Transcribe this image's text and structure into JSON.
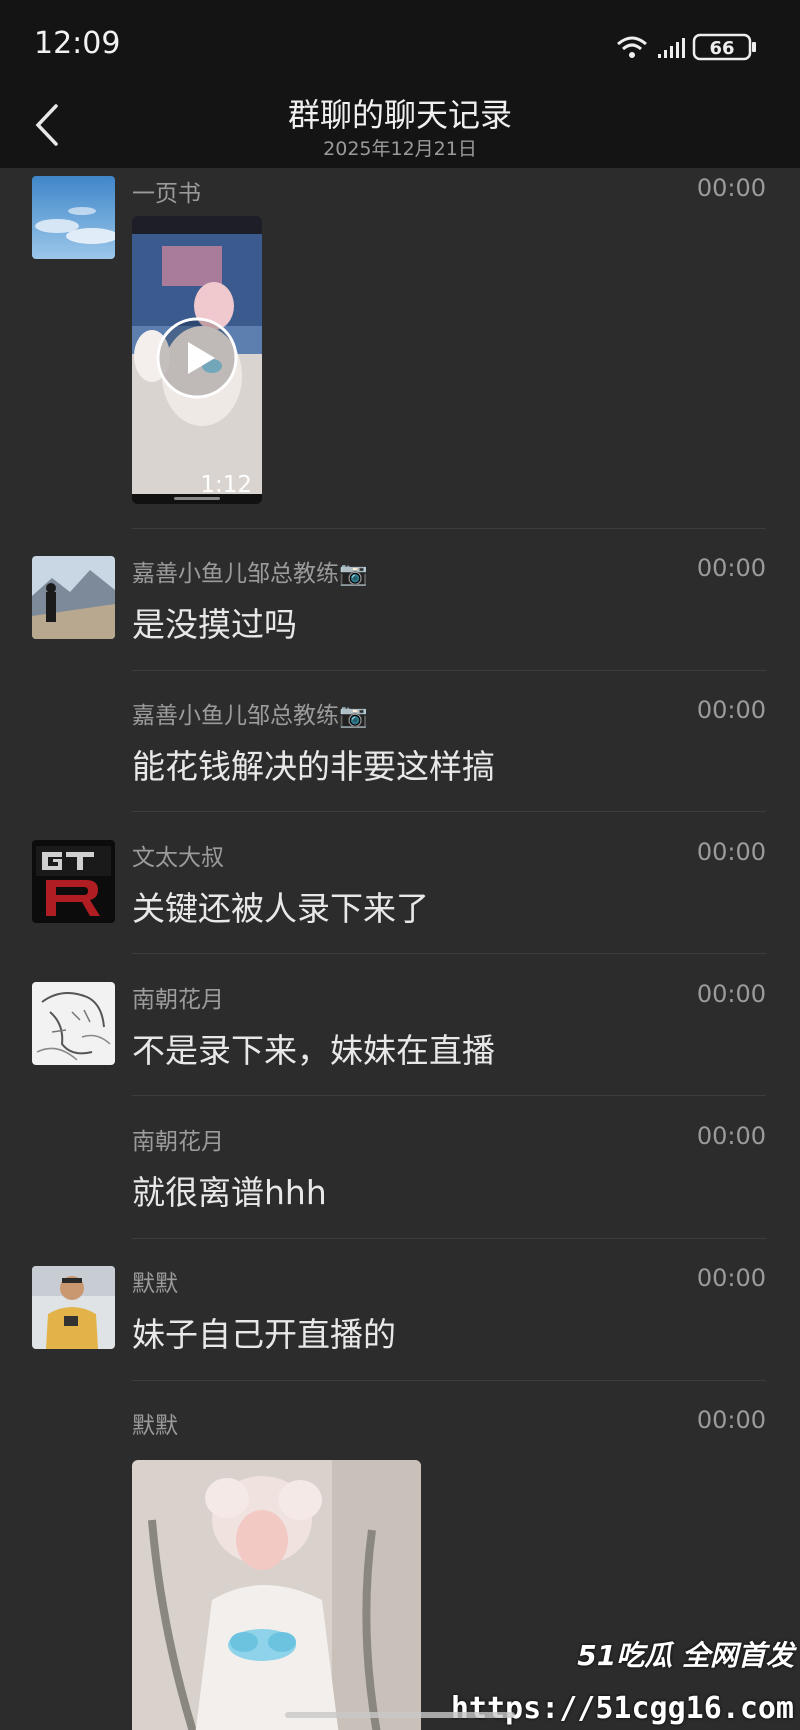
{
  "status": {
    "time": "12:09",
    "battery": "66"
  },
  "header": {
    "title": "群聊的聊天记录",
    "date": "2025年12月21日"
  },
  "messages": [
    {
      "sender": "一页书",
      "time": "00:00",
      "video_duration": "1:12"
    },
    {
      "sender": "嘉善小鱼儿邹总教练📷",
      "time": "00:00",
      "text": "是没摸过吗"
    },
    {
      "sender": "嘉善小鱼儿邹总教练📷",
      "time": "00:00",
      "text": "能花钱解决的非要这样搞"
    },
    {
      "sender": "文太大叔",
      "time": "00:00",
      "text": "关键还被人录下来了"
    },
    {
      "sender": "南朝花月",
      "time": "00:00",
      "text": "不是录下来，妹妹在直播"
    },
    {
      "sender": "南朝花月",
      "time": "00:00",
      "text": "就很离谱hhh"
    },
    {
      "sender": "默默",
      "time": "00:00",
      "text": "妹子自己开直播的"
    },
    {
      "sender": "默默",
      "time": "00:00"
    }
  ],
  "watermark": {
    "brand": "51吃瓜 全网首发",
    "url": "https://51cgg16.com"
  },
  "colors": {
    "background": "#2c2c2c",
    "bar": "#141414",
    "secondary_text": "#9b9b9b",
    "primary_text": "#e8e8e8"
  }
}
